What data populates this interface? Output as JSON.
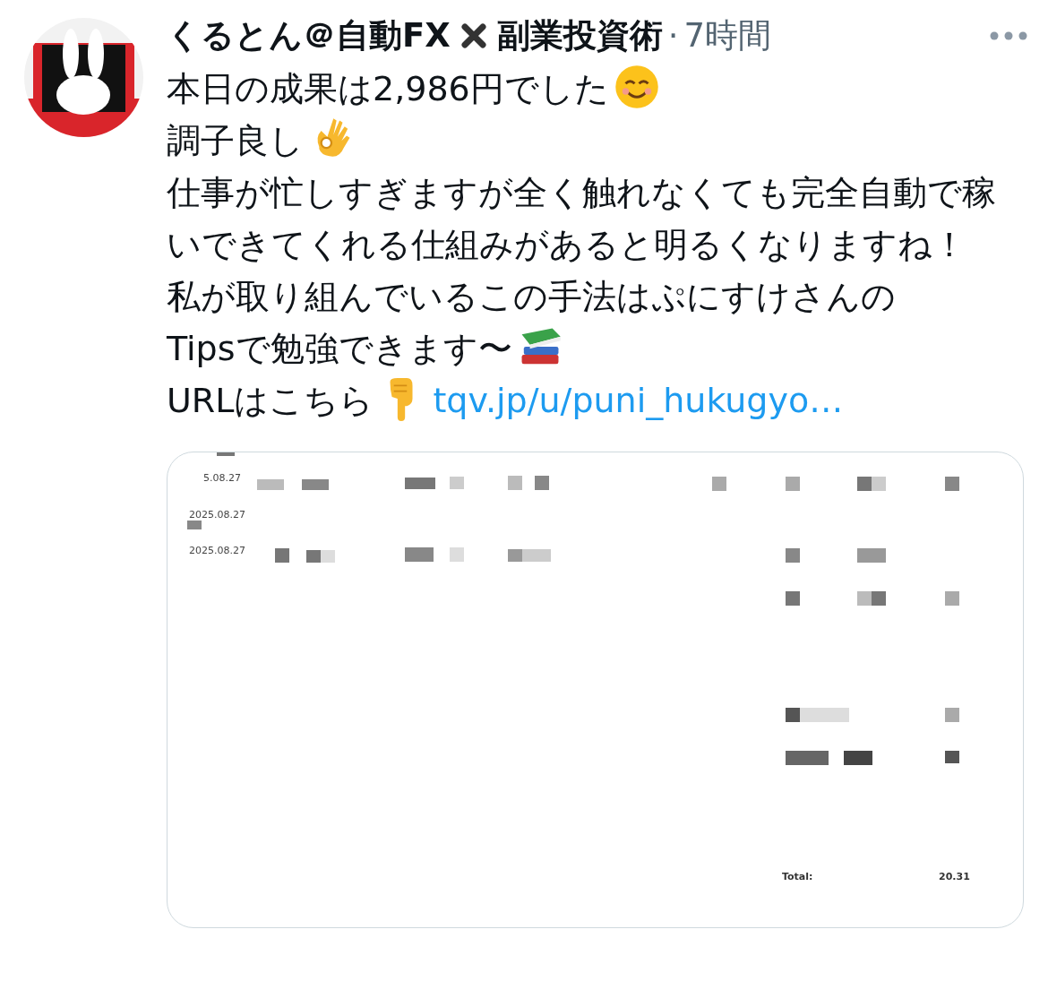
{
  "author": {
    "name_before": "くるとん＠自動FX",
    "name_after": "副業投資術",
    "separator": "·",
    "time": "7時間"
  },
  "lines": [
    {
      "text": "本日の成果は2,986円でした",
      "kind": "smile"
    },
    {
      "text": "調子良し",
      "kind": "ok-hand"
    },
    {
      "text": "仕事が忙しすぎますが全く触れなくても完全自動で稼いできてくれる仕組みがあると明るくなりますね！",
      "kind": "plain"
    },
    {
      "text": "私が取り組んでいるこの手法はぷにすけさんの",
      "kind": "plain"
    },
    {
      "text": "Tipsで勉強できます〜",
      "kind": "books"
    },
    {
      "text": "URLはこちら",
      "kind": "point-down",
      "link": "tqv.jp/u/puni_hukugyo…"
    }
  ],
  "attachment": {
    "dates": [
      "5.08.27",
      "2025.08.27",
      "2025.08.27"
    ],
    "total_label": "Total:",
    "total_value": "20.31"
  }
}
